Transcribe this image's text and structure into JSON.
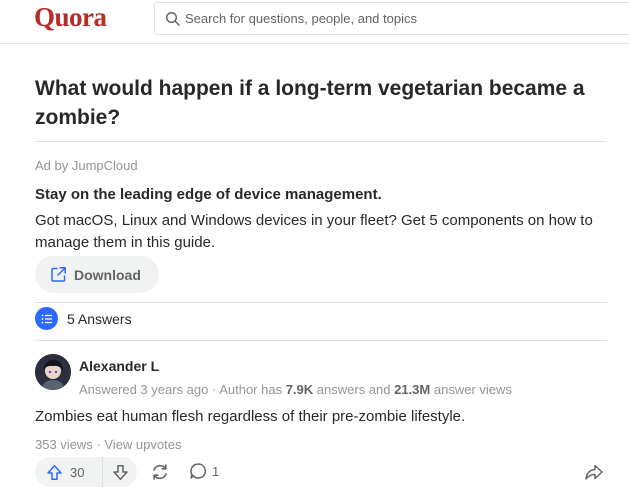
{
  "header": {
    "logo": "Quora",
    "search_placeholder": "Search for questions, people, and topics",
    "search_value": ""
  },
  "question": {
    "title": "What would happen if a long-term vegetarian became a zombie?"
  },
  "ad": {
    "label": "Ad by JumpCloud",
    "title": "Stay on the leading edge of device management.",
    "body": "Got macOS, Linux and Windows devices in your fleet? Get 5 components on how to manage them in this guide.",
    "button_label": "Download",
    "button_icon": "external-link-icon"
  },
  "answers": {
    "count_label": "5 Answers",
    "icon": "list-icon"
  },
  "answer": {
    "author": "Alexander L",
    "answered": "Answered 3 years ago",
    "separator": " · ",
    "author_has": "Author has ",
    "answer_count": "7.9K",
    "answers_and": " answers and ",
    "view_count": "21.3M",
    "answer_views": " answer views",
    "text": "Zombies eat human flesh regardless of their pre-zombie lifestyle.",
    "views": "353 views",
    "view_upvotes": "View upvotes",
    "upvotes": "30",
    "comments": "1"
  },
  "colors": {
    "brand": "#b92b27",
    "accent": "#2e69ff",
    "text": "#282829",
    "muted": "#939598",
    "pill": "#f1f2f2"
  }
}
